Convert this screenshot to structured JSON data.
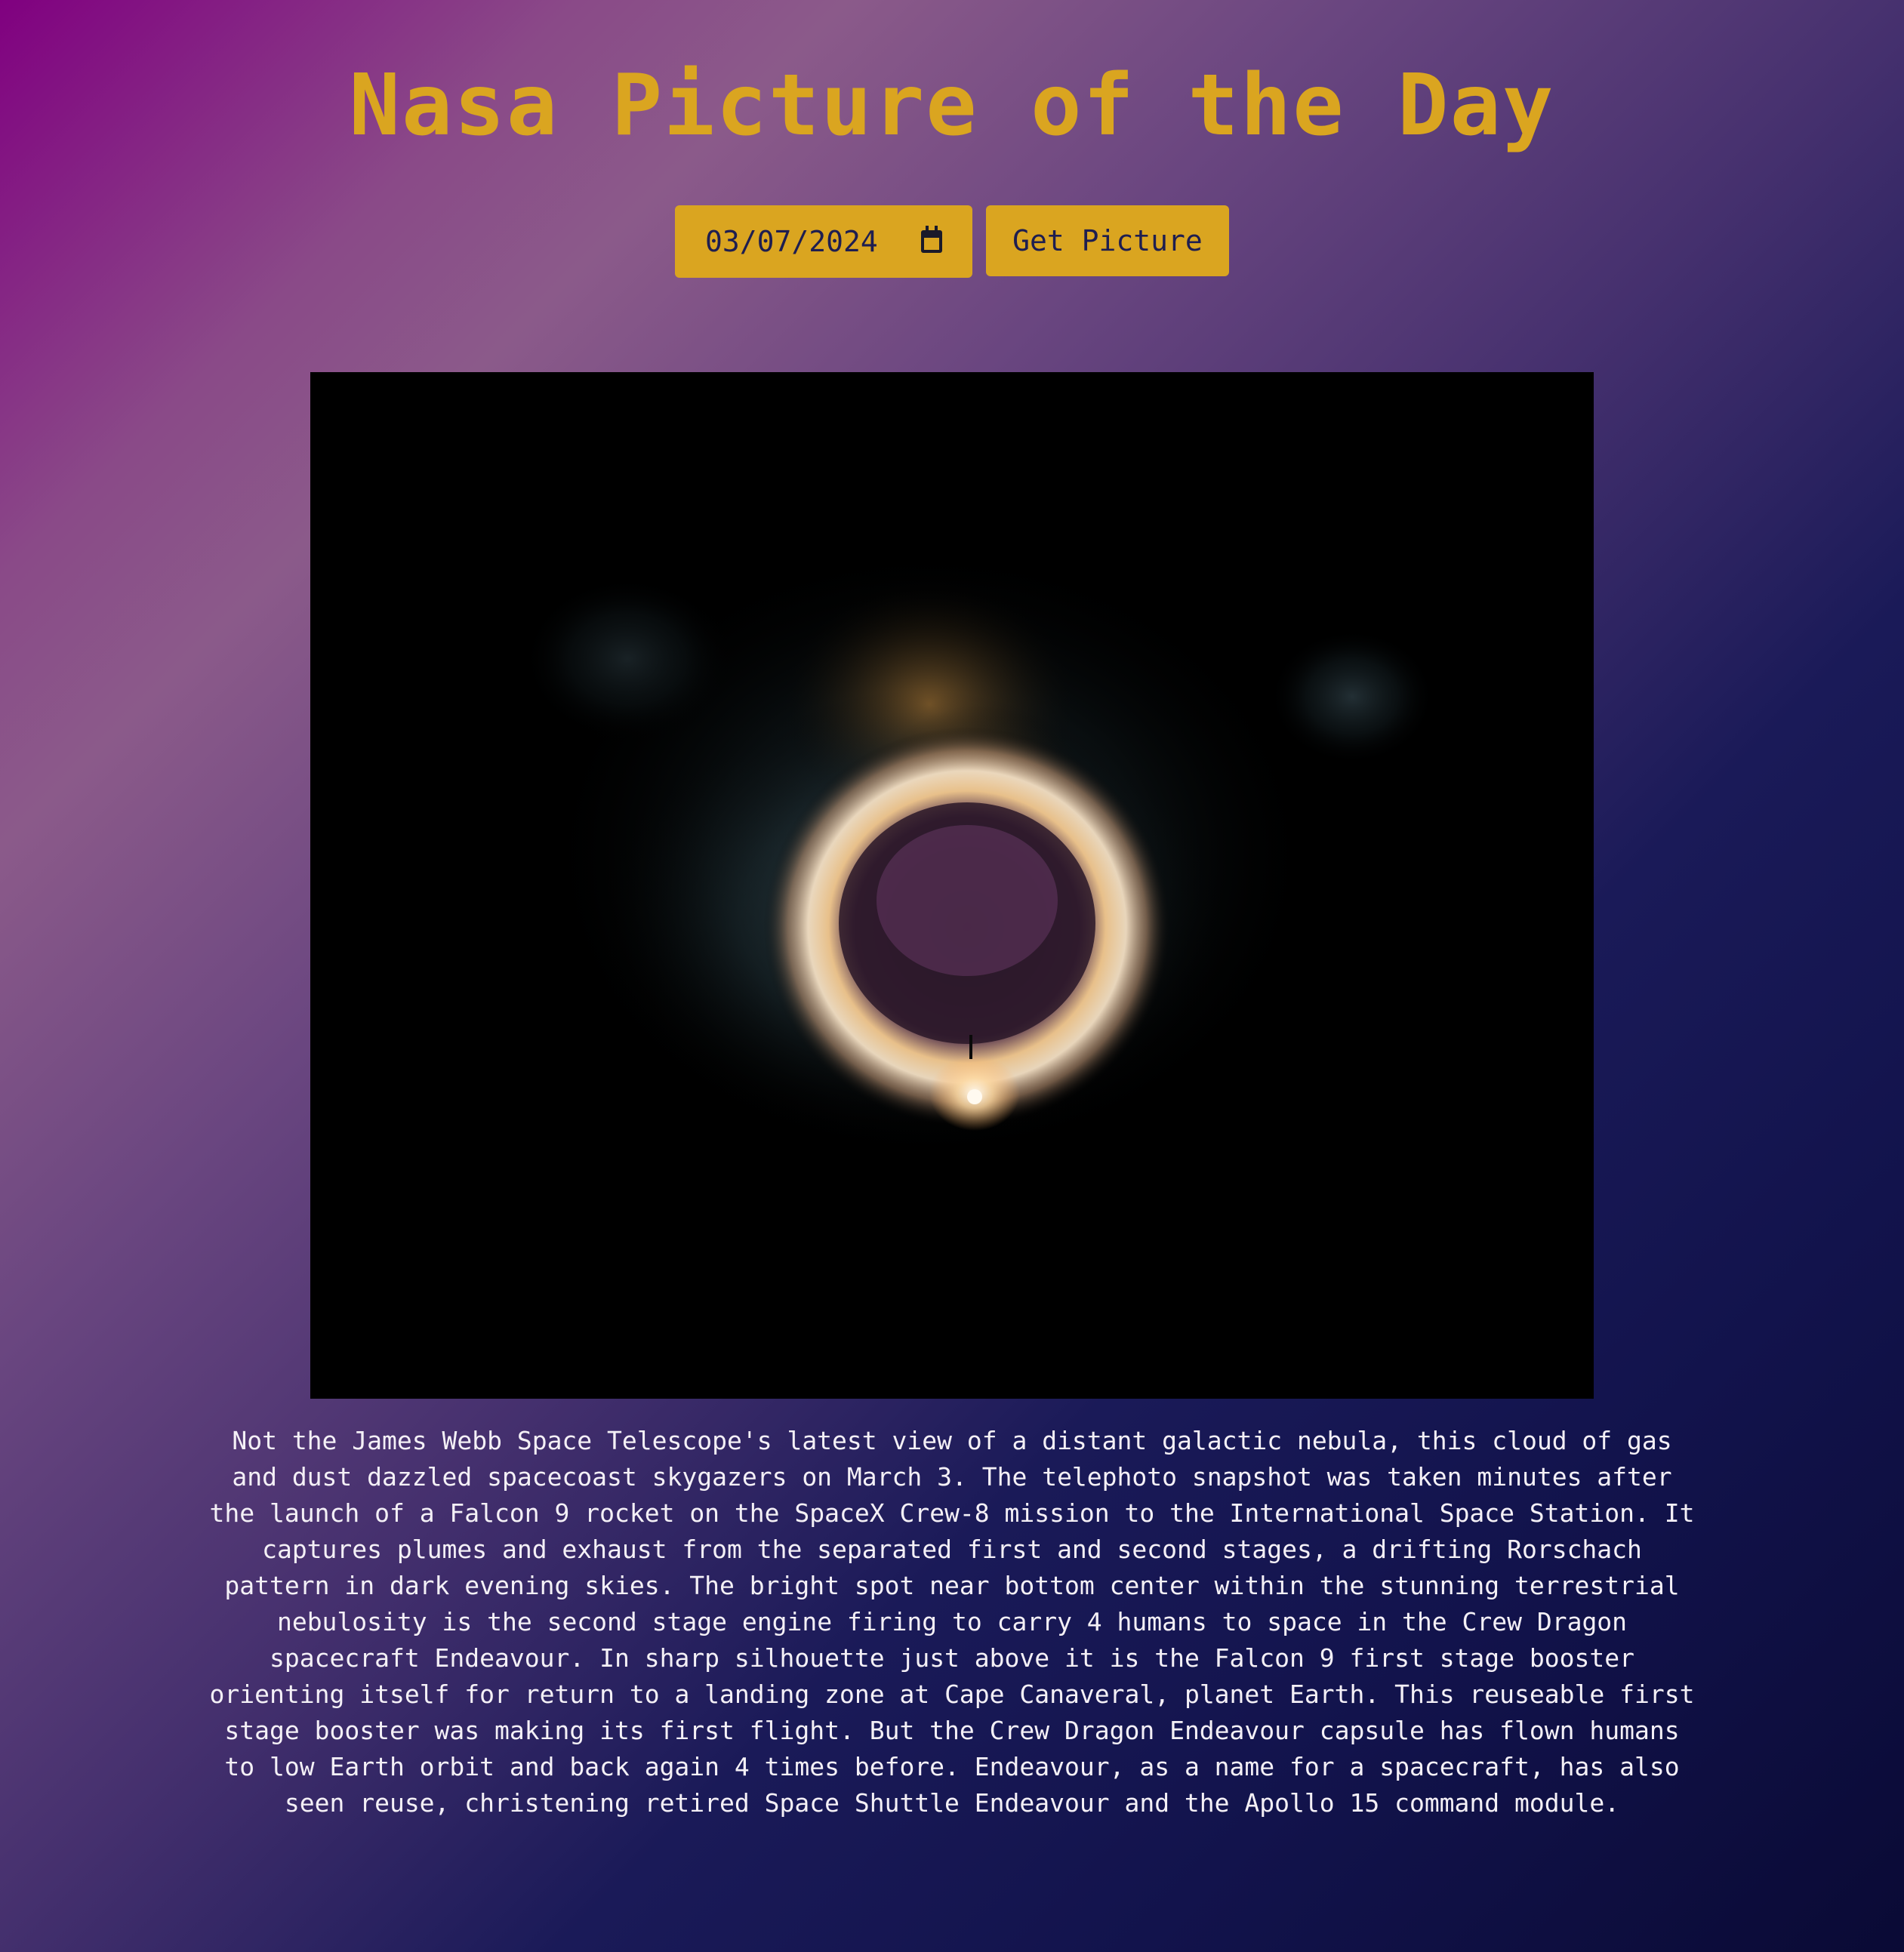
{
  "page": {
    "title": "Nasa Picture of the Day"
  },
  "controls": {
    "date_value": "03/07/2024",
    "get_button_label": "Get Picture"
  },
  "picture": {
    "explanation": "Not the James Webb Space Telescope's latest view of a distant galactic nebula, this cloud of gas and dust dazzled spacecoast skygazers on March 3. The telephoto snapshot was taken minutes after the launch of a Falcon 9 rocket on the SpaceX Crew-8 mission to the International Space Station. It captures plumes and exhaust from the separated first and second stages, a drifting Rorschach pattern in dark evening skies. The bright spot near bottom center within the stunning terrestrial nebulosity is the second stage engine firing to carry 4 humans to space in the Crew Dragon spacecraft Endeavour. In sharp silhouette just above it is the Falcon 9 first stage booster orienting itself for return to a landing zone at Cape Canaveral, planet Earth. This reuseable first stage booster was making its first flight. But the Crew Dragon Endeavour capsule has flown humans to low Earth orbit and back again 4 times before. Endeavour, as a name for a spacecraft, has also seen reuse, christening retired Space Shuttle Endeavour and the Apollo 15 command module."
  },
  "colors": {
    "accent": "#DAA520",
    "button_text": "#1e1e50",
    "text": "#f4f0f6",
    "image_background": "#000000"
  },
  "icons": {
    "date_picker": "calendar-icon"
  }
}
